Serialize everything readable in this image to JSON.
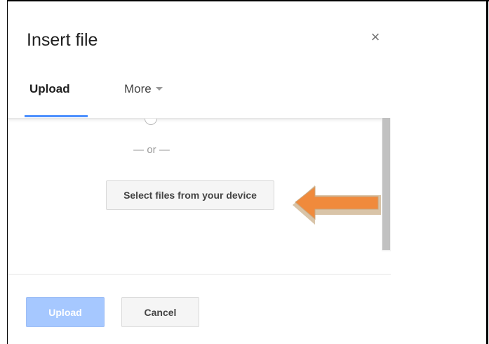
{
  "dialog": {
    "title": "Insert file",
    "close_symbol": "×"
  },
  "tabs": [
    {
      "label": "Upload",
      "active": true
    },
    {
      "label": "More",
      "has_dropdown": true
    }
  ],
  "content": {
    "separator": "— or —",
    "select_button_label": "Select files from your device"
  },
  "footer": {
    "upload_label": "Upload",
    "upload_disabled": true,
    "cancel_label": "Cancel"
  },
  "icons": {
    "close": "close-icon",
    "dropdown": "chevron-down-icon",
    "annotation": "arrow-left-icon"
  },
  "colors": {
    "accent": "#4d90fe",
    "upload_disabled_bg": "#a6c8ff",
    "annotation_arrow": "#f08a3c"
  }
}
